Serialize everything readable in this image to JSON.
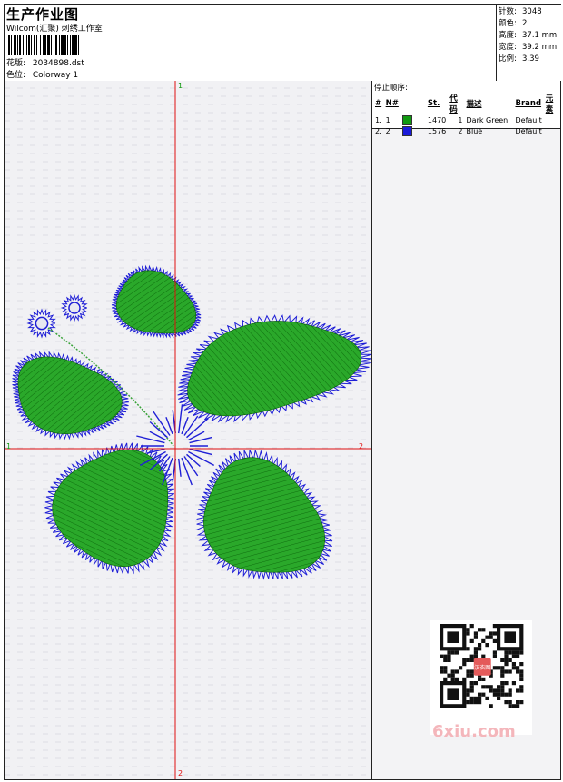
{
  "header": {
    "title": "生产作业图",
    "company": "Wilcom(汇聚) 刺绣工作室",
    "design_label": "花版:",
    "design_file": "2034898.dst",
    "colorway_label": "色位:",
    "colorway": "Colorway 1"
  },
  "stats": [
    {
      "key": "针数:",
      "value": "3048"
    },
    {
      "key": "颜色:",
      "value": "2"
    },
    {
      "key": "高度:",
      "value": "37.1 mm"
    },
    {
      "key": "宽度:",
      "value": "39.2 mm"
    },
    {
      "key": "比例:",
      "value": "3.39"
    }
  ],
  "axes": {
    "top": "1",
    "bottom": "2",
    "left": "1",
    "right": "2"
  },
  "stop_sequence": {
    "title": "停止顺序:",
    "columns": [
      "#",
      "N#",
      "St.",
      "代码",
      "描述",
      "Brand",
      "元素"
    ],
    "rows": [
      {
        "index": "1.",
        "n": "1",
        "color": "#119911",
        "stitches": "1470",
        "code": "1",
        "desc": "Dark Green",
        "brand": "Default",
        "element": ""
      },
      {
        "index": "2.",
        "n": "2",
        "color": "#1a1ad8",
        "stitches": "1576",
        "code": "2",
        "desc": "Blue",
        "brand": "Default",
        "element": ""
      }
    ]
  },
  "colors": {
    "green": "#22a022",
    "blue": "#1f1fd6",
    "axis": "#e01010"
  },
  "watermark": "6xiu.com",
  "qr_badge": "汉衣图"
}
